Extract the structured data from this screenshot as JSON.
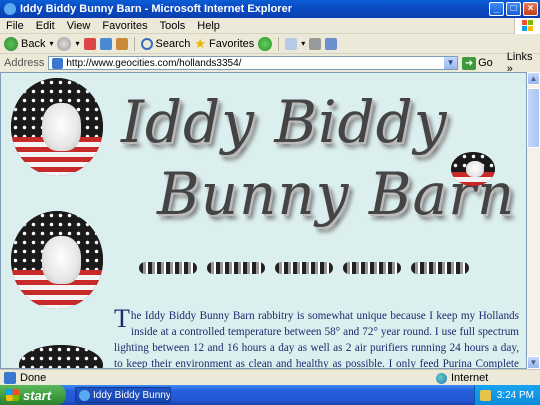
{
  "window": {
    "title": "Iddy Biddy Bunny Barn - Microsoft Internet Explorer",
    "controls": {
      "minimize": "_",
      "maximize": "□",
      "close": "×"
    }
  },
  "menu": [
    "File",
    "Edit",
    "View",
    "Favorites",
    "Tools",
    "Help"
  ],
  "toolbar": {
    "back": "Back",
    "search": "Search",
    "favorites": "Favorites"
  },
  "address": {
    "label": "Address",
    "url": "http://www.geocities.com/hollands3354/",
    "go": "Go",
    "links": "Links"
  },
  "page": {
    "banner_line1": "Iddy Biddy",
    "banner_line2": "Bunny Barn",
    "dropcap": "T",
    "paragraph": "he Iddy Biddy Bunny Barn rabbitry is somewhat unique because I keep my Hollands inside at a controlled temperature between 58° and 72° year round. I use full spectrum lighting between 12 and 16 hours a day as well as 2 air purifiers running 24 hours a day, to keep their environment as clean and healthy as possible. I only feed Purina Complete Show Rabbit Pellets and alfalfa."
  },
  "status": {
    "text": "Done",
    "zone": "Internet"
  },
  "taskbar": {
    "start": "start",
    "task": "Iddy Biddy Bunny Bar...",
    "time": "3:24 PM"
  },
  "colors": {
    "titlebar": "#0b4bc2",
    "page_bg": "#dcefef",
    "text": "#1b2a6e",
    "start_green": "#3c9a3c"
  }
}
